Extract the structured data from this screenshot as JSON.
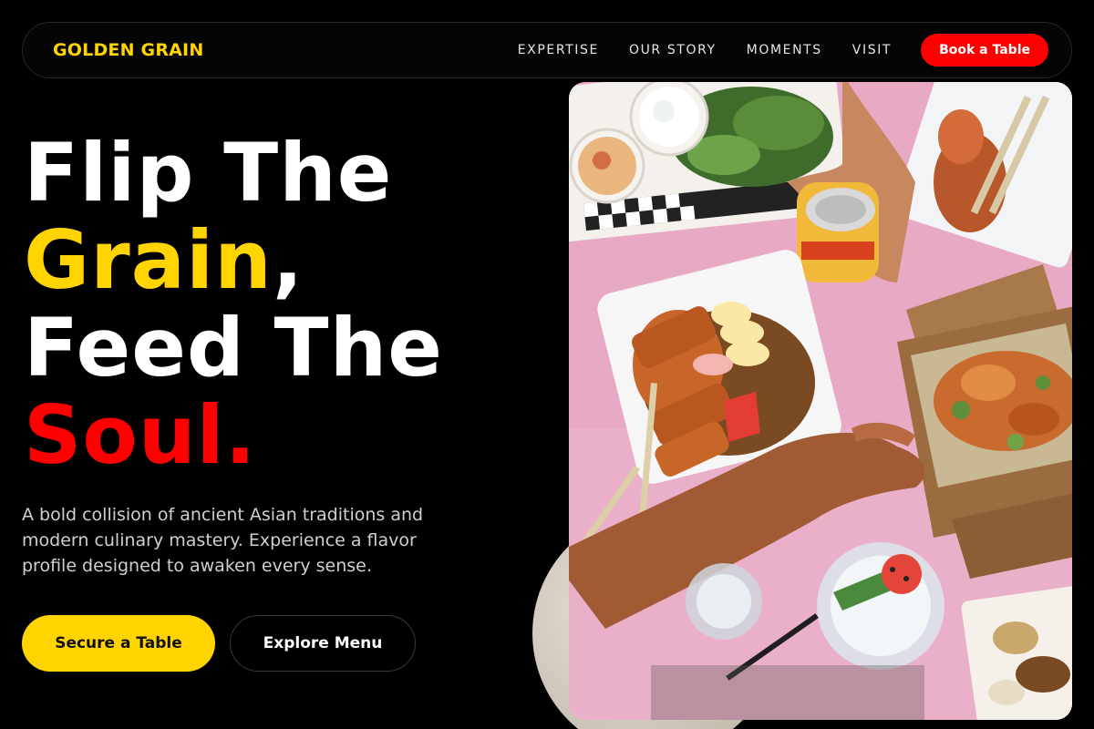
{
  "brand": {
    "name": "GOLDEN GRAIN"
  },
  "nav": {
    "links": [
      "EXPERTISE",
      "OUR STORY",
      "MOMENTS",
      "VISIT"
    ],
    "cta_label": "Book a Table"
  },
  "hero": {
    "headline": {
      "line1": "Flip The",
      "line2_highlight": "Grain",
      "line2_rest": ",",
      "line3": "Feed The",
      "line4_highlight": "Soul."
    },
    "subtext": "A bold collision of ancient Asian traditions and modern culinary mastery. Experience a flavor profile designed to awaken every sense.",
    "primary_cta": "Secure a Table",
    "secondary_cta": "Explore Menu",
    "image_alt": "Overhead view of Asian street food on a pink table"
  },
  "colors": {
    "background": "#000000",
    "brand_yellow": "#ffd400",
    "accent_red": "#ff0000",
    "text_white": "#ffffff",
    "muted_text": "#cfcfcf"
  }
}
